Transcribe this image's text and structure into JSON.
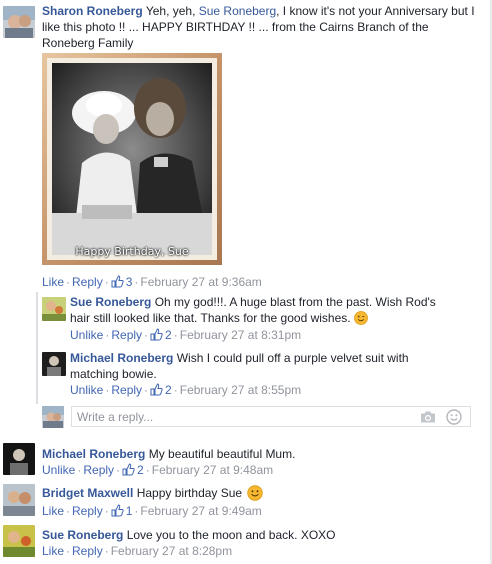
{
  "comments": [
    {
      "name": "Sharon Roneberg",
      "text_a": "Yeh, yeh, ",
      "mention": "Sue Roneberg",
      "text_b": ", I know it's not your Anniversary but I like this photo !! ... HAPPY BIRTHDAY !! ... from the Cairns Branch of the Roneberg Family",
      "photo_caption": "Happy Birthday, Sue",
      "like": "Like",
      "reply": "Reply",
      "likes": "3",
      "time": "February 27 at 9:36am"
    },
    {
      "name": "Sue Roneberg",
      "text": "Oh my god!!!. A huge blast from the past. Wish Rod's hair still looked like that. Thanks for the good wishes.",
      "like": "Unlike",
      "reply": "Reply",
      "likes": "2",
      "time": "February 27 at 8:31pm"
    },
    {
      "name": "Michael Roneberg",
      "text": "Wish I could pull off a purple velvet suit with matching bowie.",
      "like": "Unlike",
      "reply": "Reply",
      "likes": "2",
      "time": "February 27 at 8:55pm"
    },
    {
      "name": "Michael Roneberg",
      "text": "My beautiful beautiful Mum.",
      "like": "Unlike",
      "reply": "Reply",
      "likes": "2",
      "time": "February 27 at 9:48am"
    },
    {
      "name": "Bridget Maxwell",
      "text": "Happy birthday Sue",
      "like": "Like",
      "reply": "Reply",
      "likes": "1",
      "time": "February 27 at 9:49am"
    },
    {
      "name": "Sue Roneberg",
      "text": "Love you to the moon and back. XOXO",
      "like": "Like",
      "reply": "Reply",
      "time": "February 27 at 8:28pm"
    }
  ],
  "reply_box": {
    "placeholder": "Write a reply..."
  },
  "colors": {
    "link": "#365899",
    "meta": "#90949c",
    "emoji": "#f7b731"
  }
}
